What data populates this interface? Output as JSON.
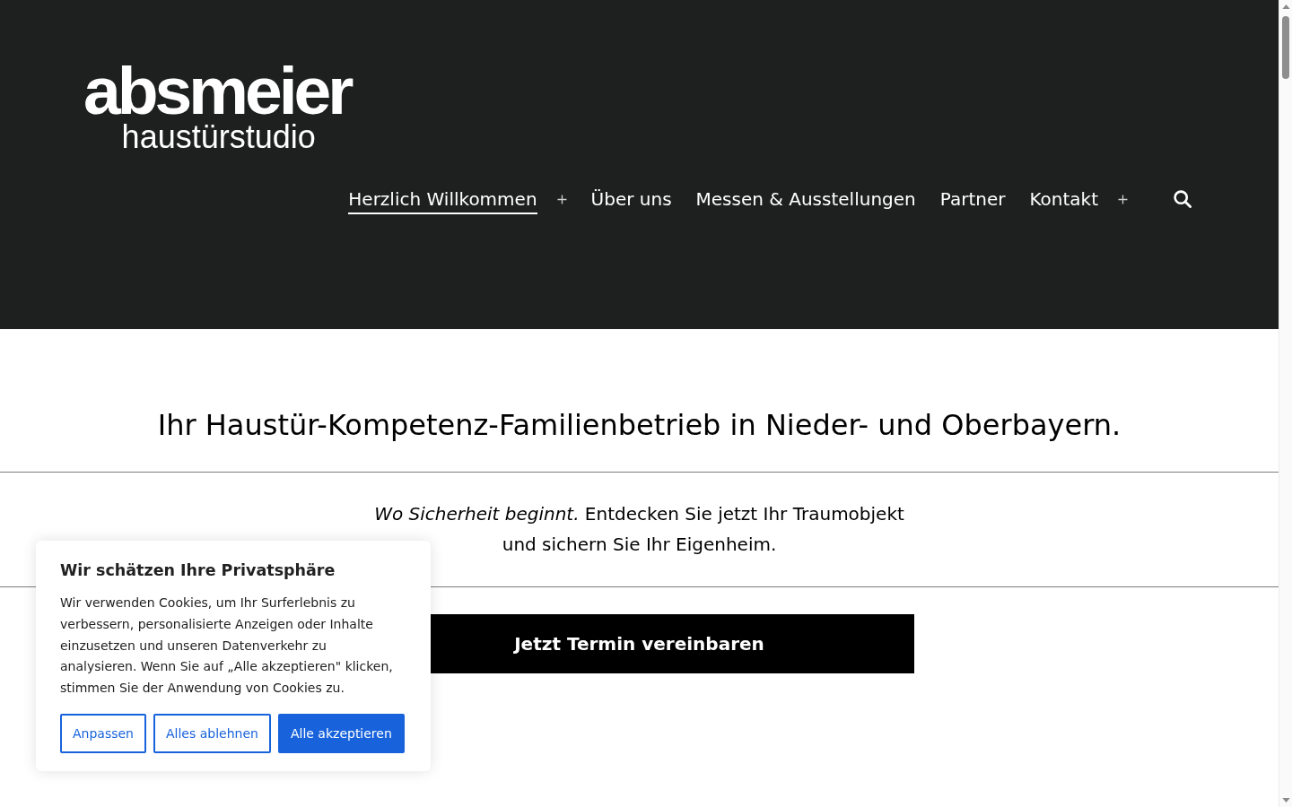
{
  "header": {
    "logo": {
      "name": "absmeier",
      "tagline": "haustürstudio"
    },
    "nav": [
      {
        "label": "Herzlich Willkommen",
        "selected": true,
        "submenu": true
      },
      {
        "label": "Über uns",
        "selected": false,
        "submenu": false
      },
      {
        "label": "Messen & Ausstellungen",
        "selected": false,
        "submenu": false
      },
      {
        "label": "Partner",
        "selected": false,
        "submenu": false
      },
      {
        "label": "Kontakt",
        "selected": false,
        "submenu": true
      }
    ]
  },
  "hero": {
    "heading": "Ihr Haustür-Kompetenz-Familienbetrieb in Nieder- und Oberbayern.",
    "text": "*Wo Sicherheit beginnt.* Entdecken Sie jetzt Ihr Traumobjekt und sichern Sie Ihr Eigenheim.",
    "button": "Jetzt Termin vereinbaren"
  },
  "cookie_banner": {
    "title": "Wir schätzen Ihre Privatsphäre",
    "text": "Wir verwenden Cookies, um Ihr Surferlebnis zu verbessern, personalisierte Anzeigen oder Inhalte einzusetzen und unseren Datenverkehr zu analysieren. Wenn Sie auf „Alle akzeptieren\" klicken, stimmen Sie der Anwendung von Cookies zu.",
    "buttons": [
      {
        "label": "Anpassen",
        "kind": "outline"
      },
      {
        "label": "Alles ablehnen",
        "kind": "outline"
      },
      {
        "label": "Alle akzeptieren",
        "kind": "primary"
      }
    ]
  }
}
